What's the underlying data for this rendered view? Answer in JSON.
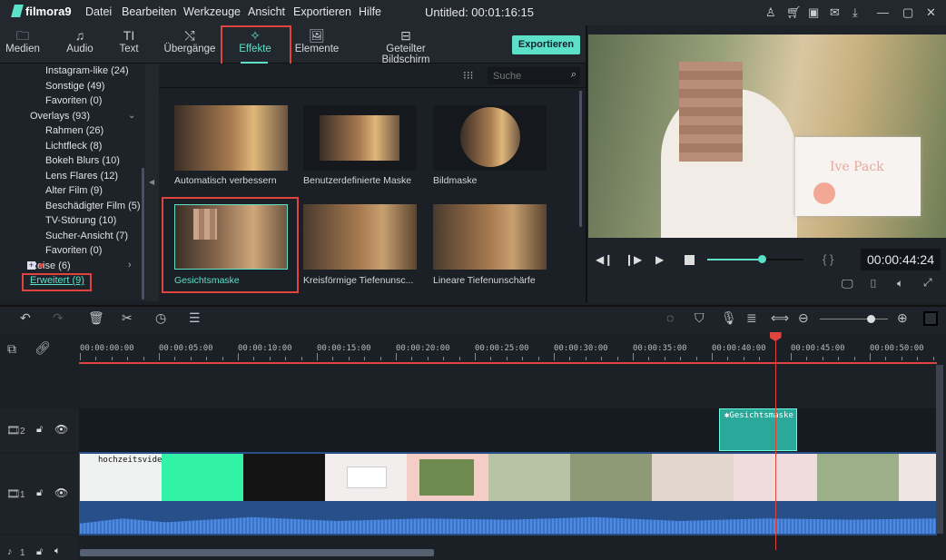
{
  "app": {
    "logo": "filmora9",
    "title": "Untitled: 00:01:16:15"
  },
  "menu": [
    "Datei",
    "Bearbeiten",
    "Werkzeuge",
    "Ansicht",
    "Exportieren",
    "Hilfe"
  ],
  "title_icons": [
    "user-icon",
    "cart-icon",
    "save-icon",
    "mail-icon",
    "download-icon",
    "minimize-icon",
    "maximize-icon",
    "close-icon"
  ],
  "tabs": [
    {
      "label": "Medien",
      "icon": "folder"
    },
    {
      "label": "Audio",
      "icon": "music-note"
    },
    {
      "label": "Text",
      "icon": "text"
    },
    {
      "label": "Übergänge",
      "icon": "transition"
    },
    {
      "label": "Effekte",
      "icon": "sparkle",
      "active": true
    },
    {
      "label": "Elemente",
      "icon": "image"
    },
    {
      "label": "Geteilter Bildschirm",
      "icon": "split-screen"
    }
  ],
  "export_label": "Exportieren",
  "sidebar": {
    "items": [
      {
        "label": "Instagram-like (24)",
        "level": 2
      },
      {
        "label": "Sonstige (49)",
        "level": 2
      },
      {
        "label": "Favoriten (0)",
        "level": 2
      },
      {
        "label": "Overlays (93)",
        "level": 1
      },
      {
        "label": "Rahmen (26)",
        "level": 2
      },
      {
        "label": "Lichtfleck (8)",
        "level": 2
      },
      {
        "label": "Bokeh Blurs (10)",
        "level": 2
      },
      {
        "label": "Lens Flares (12)",
        "level": 2
      },
      {
        "label": "Alter Film (9)",
        "level": 2
      },
      {
        "label": "Beschädigter Film (5)",
        "level": 2
      },
      {
        "label": "TV-Störung (10)",
        "level": 2
      },
      {
        "label": "Sucher-Ansicht (7)",
        "level": 2
      },
      {
        "label": "Favoriten (0)",
        "level": 2
      },
      {
        "label": "Reise (6)",
        "level": 1
      },
      {
        "label": "Erweitert (9)",
        "level": 0,
        "selected": true
      }
    ]
  },
  "search": {
    "placeholder": "Suche"
  },
  "effects": [
    {
      "label": "Automatisch verbessern"
    },
    {
      "label": "Benutzerdefinierte Maske"
    },
    {
      "label": "Bildmaske"
    },
    {
      "label": "Gesichtsmaske",
      "selected": true
    },
    {
      "label": "Kreisförmige Tiefenunsc..."
    },
    {
      "label": "Lineare Tiefenunschärfe"
    }
  ],
  "preview": {
    "overlay_text": "Ive Pack",
    "timecode": "00:00:44:24",
    "progress": 0.57,
    "bracket_label": "{ }"
  },
  "timeline": {
    "ruler": [
      "00:00:00:00",
      "00:00:05:00",
      "00:00:10:00",
      "00:00:15:00",
      "00:00:20:00",
      "00:00:25:00",
      "00:00:30:00",
      "00:00:35:00",
      "00:00:40:00",
      "00:00:45:00",
      "00:00:50:00"
    ],
    "playhead": "00:00:44:00",
    "zoom_level": 0.75,
    "tracks": [
      {
        "label": "2"
      },
      {
        "label": "1"
      },
      {
        "label": "1"
      }
    ],
    "effect_clip": "Gesichtsmaske",
    "video_clip_title": "hochzeitsvideo",
    "colors": {
      "accent": "#5ce0c8",
      "playhead": "#e0443e",
      "audio": "#3f78c8",
      "effect_clip": "#2aa99a"
    }
  }
}
